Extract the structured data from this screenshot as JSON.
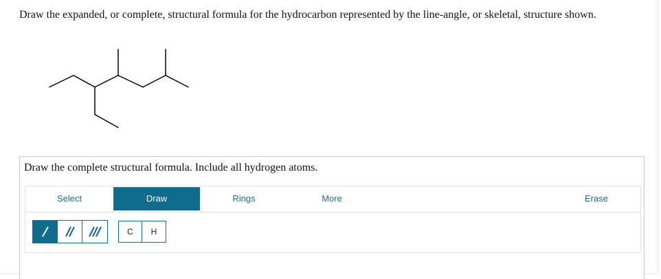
{
  "question": {
    "prompt": "Draw the expanded, or complete, structural formula for the hydrocarbon represented by the line-angle, or skeletal, structure shown."
  },
  "answer": {
    "title": "Draw the complete structural formula. Include all hydrogen atoms."
  },
  "toolbar": {
    "tabs": [
      {
        "label": "Select",
        "active": false
      },
      {
        "label": "Draw",
        "active": true
      },
      {
        "label": "Rings",
        "active": false
      },
      {
        "label": "More",
        "active": false
      },
      {
        "label": "Erase",
        "active": false
      }
    ]
  },
  "bond_tools": [
    {
      "name": "single-bond",
      "active": true
    },
    {
      "name": "double-bond",
      "active": false
    },
    {
      "name": "triple-bond",
      "active": false
    }
  ],
  "atom_tools": [
    "C",
    "H"
  ],
  "colors": {
    "accent": "#0f6c8a",
    "tab_text": "#1a6f8c"
  }
}
